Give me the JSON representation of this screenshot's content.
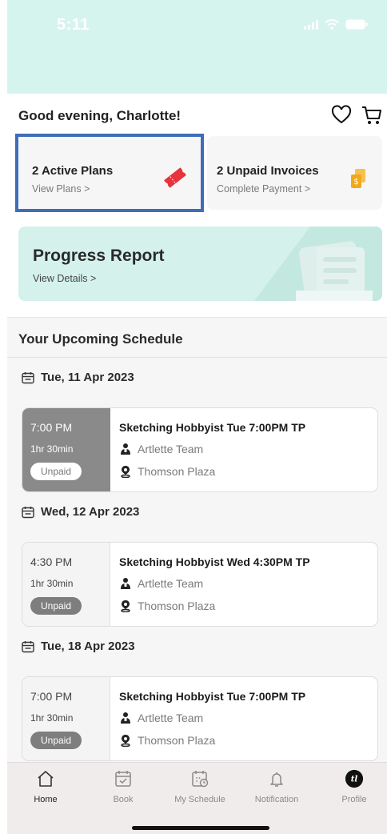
{
  "status_bar": {
    "time": "5:11"
  },
  "header": {
    "greeting": "Good evening, Charlotte!",
    "icons": [
      "heart-icon",
      "cart-icon"
    ]
  },
  "cards": {
    "plans": {
      "title": "2 Active Plans",
      "subtitle": "View Plans >",
      "icon": "ticket-icon"
    },
    "invoices": {
      "title": "2 Unpaid Invoices",
      "subtitle": "Complete Payment >",
      "icon": "money-icon"
    }
  },
  "progress_report": {
    "title": "Progress Report",
    "subtitle": "View Details >"
  },
  "schedule": {
    "title": "Your Upcoming Schedule",
    "groups": [
      {
        "date": "Tue, 11 Apr 2023",
        "event": {
          "time": "7:00 PM",
          "duration": "1hr 30min",
          "status": "Unpaid",
          "title": "Sketching Hobbyist Tue 7:00PM TP",
          "team": "Artlette Team",
          "location": "Thomson Plaza"
        }
      },
      {
        "date": "Wed, 12 Apr 2023",
        "event": {
          "time": "4:30 PM",
          "duration": "1hr 30min",
          "status": "Unpaid",
          "title": "Sketching Hobbyist Wed 4:30PM TP",
          "team": "Artlette Team",
          "location": "Thomson Plaza"
        }
      },
      {
        "date": "Tue, 18 Apr 2023",
        "event": {
          "time": "7:00 PM",
          "duration": "1hr 30min",
          "status": "Unpaid",
          "title": "Sketching Hobbyist Tue 7:00PM TP",
          "team": "Artlette Team",
          "location": "Thomson Plaza"
        }
      }
    ]
  },
  "tabbar": {
    "items": [
      {
        "label": "Home",
        "icon": "home-icon",
        "active": true
      },
      {
        "label": "Book",
        "icon": "calendar-check-icon"
      },
      {
        "label": "My Schedule",
        "icon": "calendar-clock-icon"
      },
      {
        "label": "Notification",
        "icon": "bell-icon"
      },
      {
        "label": "Profile",
        "icon": "avatar-icon"
      }
    ]
  },
  "colors": {
    "mint": "#d6f4ee",
    "highlight": "#3f6db8",
    "ticket": "#e8323c",
    "money": "#f2b21c"
  }
}
